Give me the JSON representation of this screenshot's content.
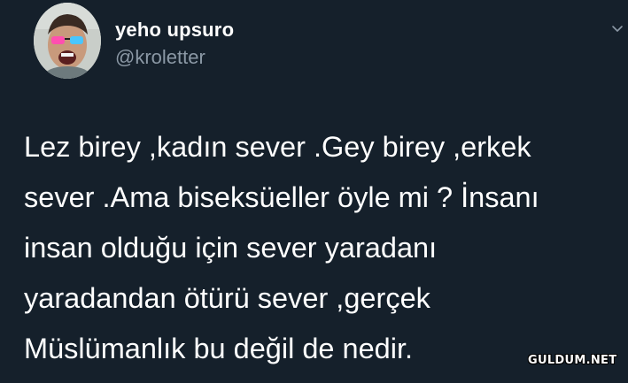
{
  "tweet": {
    "author_name": "yeho upsuro",
    "author_handle": "@kroletter",
    "avatar_icon": "profile-photo",
    "menu_icon": "chevron-down-icon",
    "text_lines": [
      "Lez birey ,kadın sever .Gey birey ,erkek",
      "sever .Ama biseksüeller öyle mi ? İnsanı",
      "insan olduğu için sever yaradanı",
      "yaradandan ötürü sever ,gerçek",
      "Müslümanlık bu değil de nedir."
    ]
  },
  "watermark": {
    "text": "GULDUM.NET"
  },
  "colors": {
    "background": "#15202b",
    "primary_text": "#ffffff",
    "secondary_text": "#8b98a5"
  }
}
